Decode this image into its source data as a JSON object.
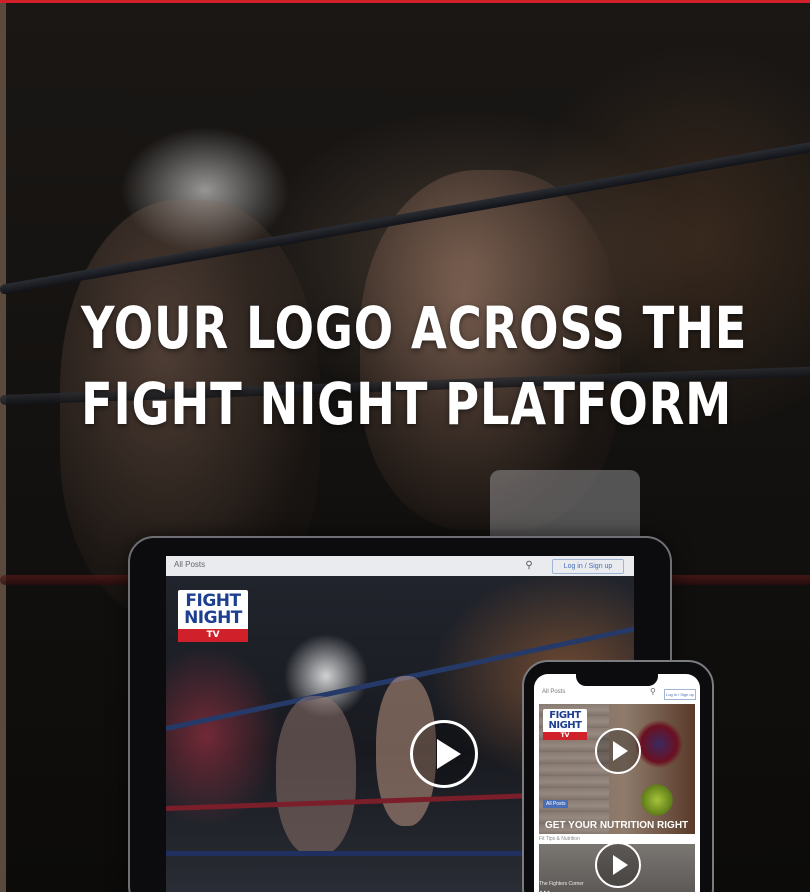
{
  "hero": {
    "headline_line1": "YOUR LOGO ACROSS THE",
    "headline_line2": "FIGHT NIGHT PLATFORM"
  },
  "tablet": {
    "nav": {
      "all_posts": "All Posts",
      "search_icon": "search-icon",
      "login": "Log in / Sign up"
    },
    "logo": {
      "line1": "FIGHT",
      "line2": "NIGHT",
      "line3": "TV"
    },
    "play_icon": "play-icon"
  },
  "phone": {
    "nav": {
      "all_posts": "All Posts",
      "search_icon": "search-icon",
      "login": "Log in / Sign up"
    },
    "logo": {
      "line1": "FIGHT",
      "line2": "NIGHT",
      "line3": "TV"
    },
    "card1": {
      "category": "All Posts",
      "title": "GET YOUR NUTRITION RIGHT",
      "meta": "Fit Tips & Nutrition"
    },
    "card2": {
      "meta": "The Fighters Corner",
      "dots": "• • •"
    }
  },
  "colors": {
    "accent_red": "#d0202a",
    "brand_blue": "#1e3f8f",
    "headline": "#ffffff"
  }
}
